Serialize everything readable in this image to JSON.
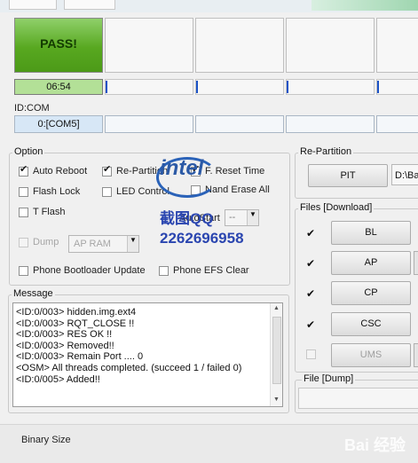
{
  "status": {
    "pass_label": "PASS!",
    "timer": "06:54"
  },
  "idcom": {
    "label": "ID:COM",
    "port": "0:[COM5]"
  },
  "option": {
    "title": "Option",
    "auto_reboot": "Auto Reboot",
    "re_partition": "Re-Partition",
    "f_reset_time": "F. Reset Time",
    "flash_lock": "Flash Lock",
    "led_control": "LED Control",
    "nand_erase_all": "Nand Erase All",
    "t_flash": "T Flash",
    "autostart_label": "AutoStart",
    "autostart_value": "--",
    "dump_label": "Dump",
    "dump_value": "AP RAM",
    "phone_bootloader_update": "Phone Bootloader Update",
    "phone_efs_clear": "Phone EFS Clear"
  },
  "repartition": {
    "title": "Re-Partition",
    "pit_button": "PIT",
    "pit_path": "D:\\Ba"
  },
  "files": {
    "title": "Files [Download]",
    "bl": "BL",
    "ap": "AP",
    "cp": "CP",
    "csc": "CSC",
    "ums": "UMS"
  },
  "message": {
    "title": "Message",
    "lines": [
      "<ID:0/003> hidden.img.ext4",
      "<ID:0/003> RQT_CLOSE !!",
      "<ID:0/003> RES OK !!",
      "<ID:0/003> Removed!!",
      "<ID:0/003> Remain Port ....  0",
      "<OSM> All threads completed. (succeed 1 / failed 0)",
      "<ID:0/005> Added!!"
    ]
  },
  "file_dump": {
    "title": "File [Dump]"
  },
  "footer": {
    "binary_size": "Binary Size"
  },
  "watermark": {
    "brand": "intel",
    "line1": "截图QQ",
    "line2": "2262696958",
    "baidu": "Bai 经验"
  }
}
